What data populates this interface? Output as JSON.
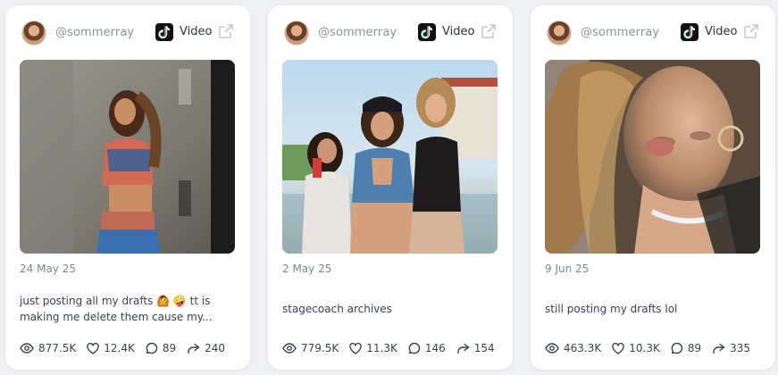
{
  "posts": [
    {
      "handle": "@sommerray",
      "type_label": "Video",
      "date": "24 May 25",
      "caption": "just posting all my drafts 🙆 🤪 tt is making me delete them cause my...",
      "views": "877.5K",
      "likes": "12.4K",
      "comments": "89",
      "shares": "240"
    },
    {
      "handle": "@sommerray",
      "type_label": "Video",
      "date": "2 May 25",
      "caption": "stagecoach archives",
      "views": "779.5K",
      "likes": "11.3K",
      "comments": "146",
      "shares": "154"
    },
    {
      "handle": "@sommerray",
      "type_label": "Video",
      "date": "9 Jun 25",
      "caption": "still posting my drafts lol",
      "views": "463.3K",
      "likes": "10.3K",
      "comments": "89",
      "shares": "335"
    }
  ]
}
